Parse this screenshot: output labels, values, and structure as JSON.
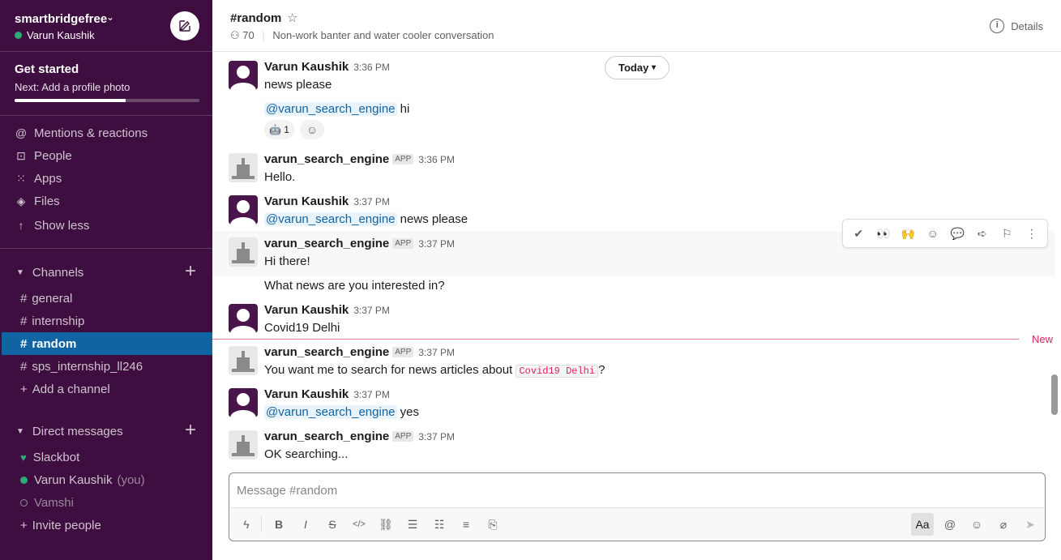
{
  "workspace": {
    "name": "smartbridgefree",
    "user": "Varun Kaushik"
  },
  "get_started": {
    "title": "Get started",
    "subtitle": "Next: Add a profile photo",
    "progress": 0.6
  },
  "nav": [
    {
      "label": "Mentions & reactions",
      "icon": "at-icon"
    },
    {
      "label": "People",
      "icon": "people-icon"
    },
    {
      "label": "Apps",
      "icon": "apps-icon"
    },
    {
      "label": "Files",
      "icon": "files-icon"
    },
    {
      "label": "Show less",
      "icon": "arrow-up-icon"
    }
  ],
  "channels_section": {
    "label": "Channels",
    "add_label": "Add a channel"
  },
  "channels": [
    {
      "name": "general"
    },
    {
      "name": "internship"
    },
    {
      "name": "random",
      "active": true
    },
    {
      "name": "sps_internship_ll246"
    }
  ],
  "dm_section": {
    "label": "Direct messages",
    "invite_label": "Invite people"
  },
  "dms": [
    {
      "name": "Slackbot"
    },
    {
      "name": "Varun Kaushik",
      "suffix": "(you)"
    },
    {
      "name": "Vamshi"
    }
  ],
  "channel": {
    "title": "#random",
    "members": "70",
    "topic": "Non-work banter and water cooler conversation",
    "details_label": "Details"
  },
  "today_label": "Today",
  "new_label": "New",
  "messages": [
    {
      "sender": "Varun Kaushik",
      "time": "3:36 PM",
      "text": "news please"
    },
    {
      "mention": "@varun_search_engine",
      "text": "hi",
      "reaction_count": "1"
    },
    {
      "sender": "varun_search_engine",
      "app_tag": "APP",
      "time": "3:36 PM",
      "text": "Hello."
    },
    {
      "sender": "Varun Kaushik",
      "time": "3:37 PM",
      "mention": "@varun_search_engine",
      "text": "news please"
    },
    {
      "sender": "varun_search_engine",
      "app_tag": "APP",
      "time": "3:37 PM",
      "text": "Hi there!"
    },
    {
      "text": "What news are you interested in?"
    },
    {
      "sender": "Varun Kaushik",
      "time": "3:37 PM",
      "text": "Covid19 Delhi"
    },
    {
      "sender": "varun_search_engine",
      "app_tag": "APP",
      "time": "3:37 PM",
      "text": "You want me to search for news articles about",
      "code": "Covid19 Delhi",
      "suffix": "?"
    },
    {
      "sender": "Varun Kaushik",
      "time": "3:37 PM",
      "mention": "@varun_search_engine",
      "text": "yes"
    },
    {
      "sender": "varun_search_engine",
      "app_tag": "APP",
      "time": "3:37 PM",
      "text": "OK searching..."
    }
  ],
  "composer": {
    "placeholder": "Message #random",
    "aa_label": "Aa"
  }
}
